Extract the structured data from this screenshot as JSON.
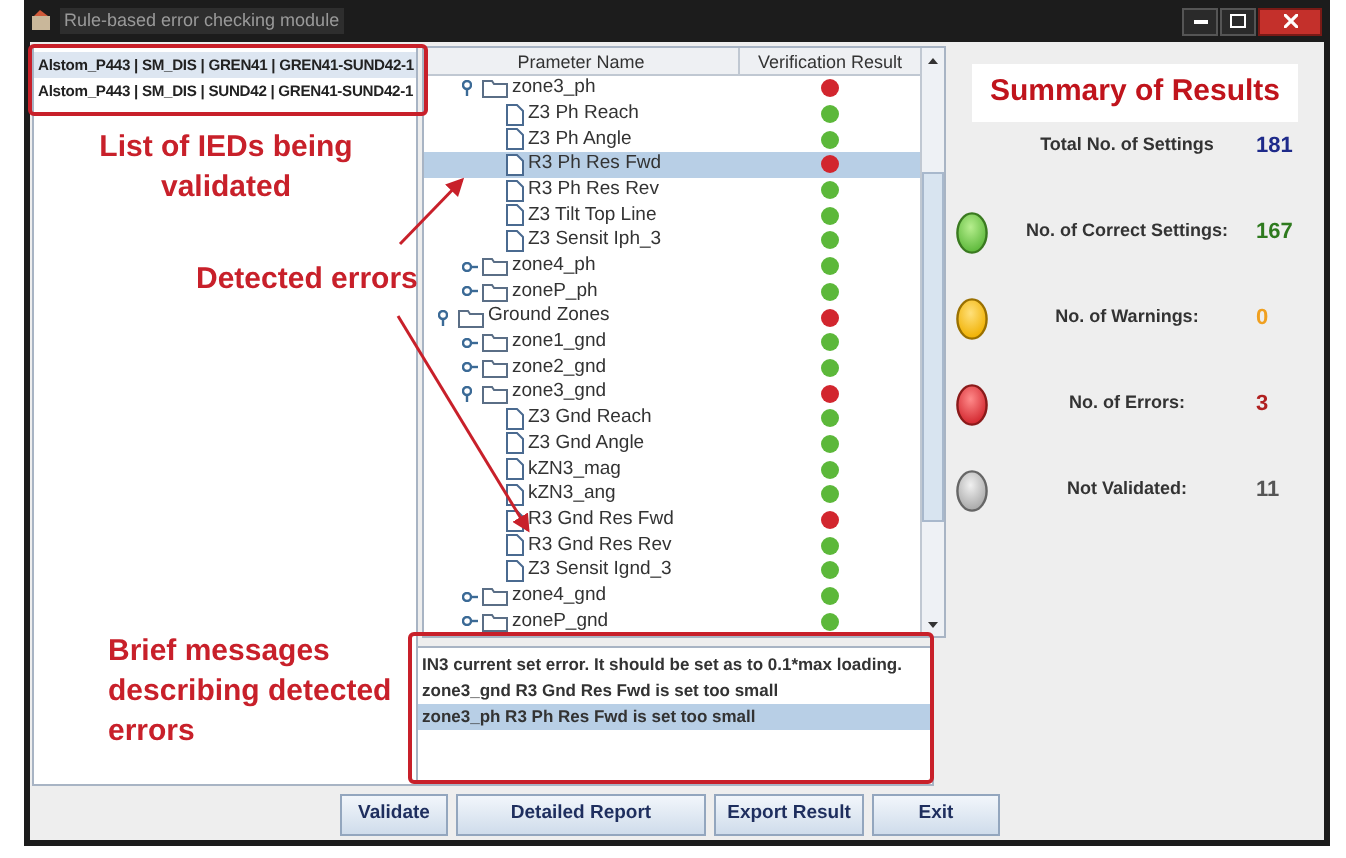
{
  "window": {
    "title": "Rule-based error checking module"
  },
  "ied_list": [
    {
      "label": "Alstom_P443 | SM_DIS | GREN41 | GREN41-SUND42-1",
      "selected": true
    },
    {
      "label": "Alstom_P443 | SM_DIS | SUND42 | GREN41-SUND42-1",
      "selected": false
    }
  ],
  "tree": {
    "columns": [
      "Prameter Name",
      "Verification Result"
    ],
    "items": [
      {
        "children": [
          {
            "label": "zone3_ph",
            "kind": "folder",
            "expanded": true,
            "color": "#d2262e",
            "selected": false,
            "children": [
              {
                "label": "Z3 Ph Reach",
                "kind": "leaf",
                "color": "#5cb83a",
                "selected": false
              },
              {
                "label": "Z3 Ph Angle",
                "kind": "leaf",
                "color": "#5cb83a",
                "selected": false
              },
              {
                "label": "R3 Ph Res Fwd",
                "kind": "leaf",
                "color": "#d2262e",
                "selected": true
              },
              {
                "label": "R3 Ph Res Rev",
                "kind": "leaf",
                "color": "#5cb83a",
                "selected": false
              },
              {
                "label": "Z3 Tilt Top Line",
                "kind": "leaf",
                "color": "#5cb83a",
                "selected": false
              },
              {
                "label": "Z3 Sensit Iph_3",
                "kind": "leaf",
                "color": "#5cb83a",
                "selected": false
              }
            ]
          },
          {
            "label": "zone4_ph",
            "kind": "folder",
            "expanded": false,
            "color": "#5cb83a",
            "selected": false
          },
          {
            "label": "zoneP_ph",
            "kind": "folder",
            "expanded": false,
            "color": "#5cb83a",
            "selected": false
          }
        ]
      },
      {
        "label": "Ground Zones",
        "kind": "folder",
        "expanded": true,
        "color": "#d2262e",
        "selected": false,
        "children": [
          {
            "label": "zone1_gnd",
            "kind": "folder",
            "expanded": false,
            "color": "#5cb83a",
            "selected": false
          },
          {
            "label": "zone2_gnd",
            "kind": "folder",
            "expanded": false,
            "color": "#5cb83a",
            "selected": false
          },
          {
            "label": "zone3_gnd",
            "kind": "folder",
            "expanded": true,
            "color": "#d2262e",
            "selected": false,
            "children": [
              {
                "label": "Z3 Gnd Reach",
                "kind": "leaf",
                "color": "#5cb83a",
                "selected": false
              },
              {
                "label": "Z3 Gnd Angle",
                "kind": "leaf",
                "color": "#5cb83a",
                "selected": false
              },
              {
                "label": "kZN3_mag",
                "kind": "leaf",
                "color": "#5cb83a",
                "selected": false
              },
              {
                "label": "kZN3_ang",
                "kind": "leaf",
                "color": "#5cb83a",
                "selected": false
              },
              {
                "label": "R3 Gnd Res Fwd",
                "kind": "leaf",
                "color": "#d2262e",
                "selected": false
              },
              {
                "label": "R3 Gnd Res Rev",
                "kind": "leaf",
                "color": "#5cb83a",
                "selected": false
              },
              {
                "label": "Z3 Sensit Ignd_3",
                "kind": "leaf",
                "color": "#5cb83a",
                "selected": false
              }
            ]
          },
          {
            "label": "zone4_gnd",
            "kind": "folder",
            "expanded": false,
            "color": "#5cb83a",
            "selected": false
          },
          {
            "label": "zoneP_gnd",
            "kind": "folder",
            "expanded": false,
            "color": "#5cb83a",
            "selected": false
          }
        ]
      }
    ]
  },
  "messages": [
    {
      "text": "IN3 current set error. It should be set as to 0.1*max loading.",
      "selected": false
    },
    {
      "text": "zone3_gnd R3 Gnd Res Fwd is set too small",
      "selected": false
    },
    {
      "text": "zone3_ph R3 Ph Res Fwd is set too small",
      "selected": true
    }
  ],
  "summary": {
    "title": "Summary of Results",
    "rows": [
      {
        "kind": "total",
        "label": "Total No. of Settings",
        "value": "181"
      },
      {
        "kind": "correct",
        "label": "No. of Correct Settings:",
        "value": "167"
      },
      {
        "kind": "warning",
        "label": "No. of Warnings:",
        "value": "0"
      },
      {
        "kind": "error",
        "label": "No. of Errors:",
        "value": "3"
      },
      {
        "kind": "not_validated",
        "label": "Not Validated:",
        "value": "11"
      }
    ]
  },
  "buttons": [
    "Validate",
    "Detailed Report",
    "Export Result",
    "Exit"
  ],
  "annotations": [
    {
      "kind": "ied_label",
      "text": "List of IEDs being validated"
    },
    {
      "kind": "errors_label",
      "text": "Detected errors"
    },
    {
      "kind": "messages_label",
      "text": "Brief messages describing detected errors"
    }
  ]
}
